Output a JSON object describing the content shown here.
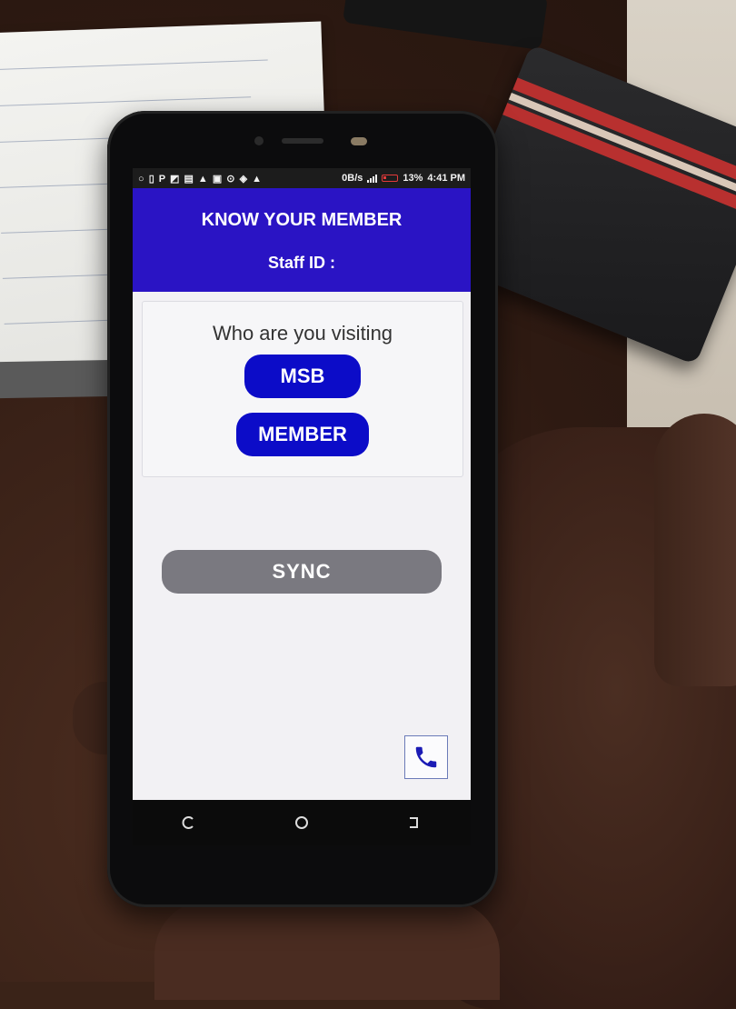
{
  "status_bar": {
    "left_icons": "○ ▯ P ◩ ▤ ▲ ▣ ⊙ ◈ ▲",
    "speed": "0B/s",
    "battery": "13%",
    "time": "4:41 PM",
    "battery_color": "#e33a3a"
  },
  "header": {
    "title": "KNOW YOUR MEMBER",
    "staff_id_label": "Staff ID :",
    "background": "#2a14c4"
  },
  "visit_card": {
    "prompt": "Who are you visiting",
    "options": [
      "MSB",
      "MEMBER"
    ],
    "button_color": "#0c0cc8"
  },
  "sync_button": {
    "label": "SYNC",
    "color": "#7a7980"
  },
  "call_button": {
    "icon": "phone-icon"
  },
  "navigation": {
    "keys": [
      "recent-apps-icon",
      "home-icon",
      "back-icon"
    ]
  }
}
